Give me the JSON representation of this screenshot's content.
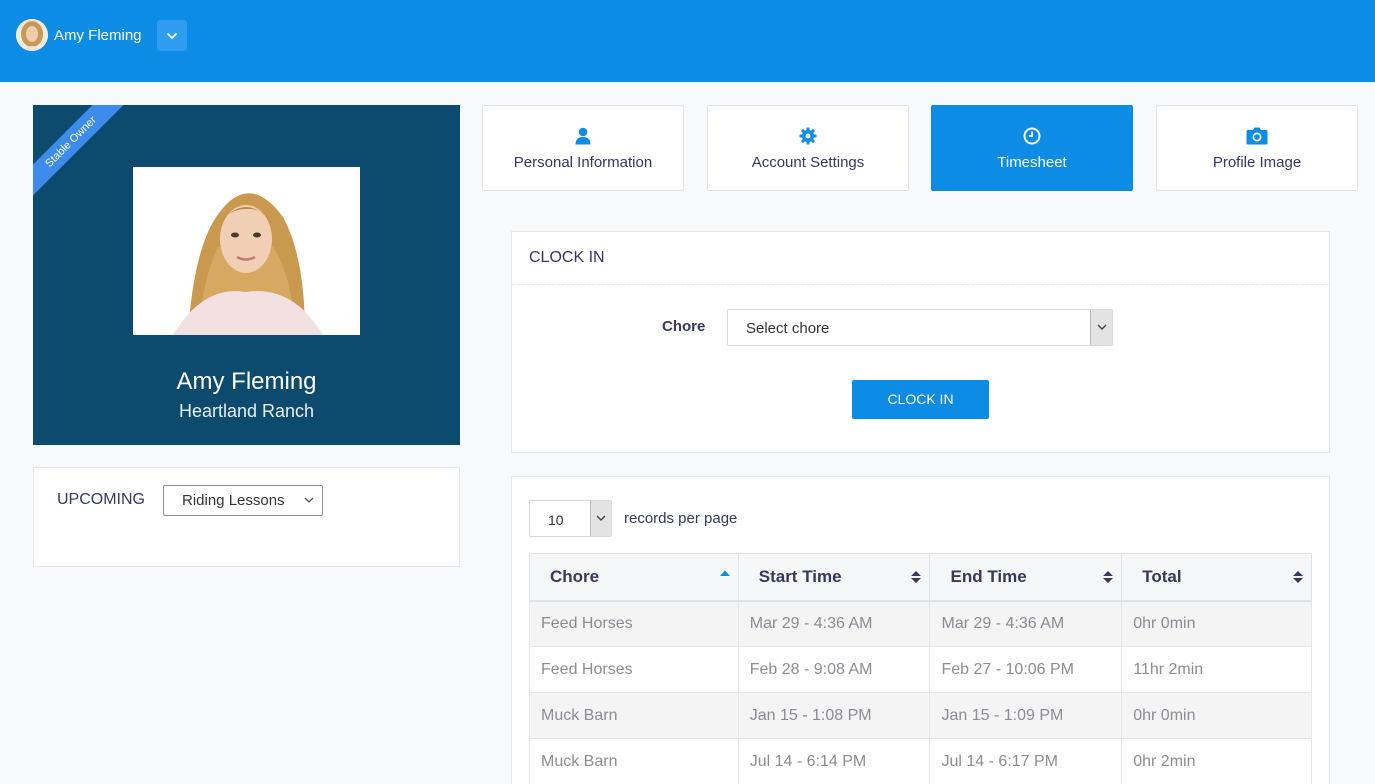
{
  "topbar": {
    "user_name": "Amy Fleming",
    "color": "#0c8ce4"
  },
  "profile": {
    "ribbon": "Stable Owner",
    "name": "Amy Fleming",
    "ranch": "Heartland Ranch",
    "card_color": "#0c4a6e"
  },
  "upcoming": {
    "label": "UPCOMING",
    "selected": "Riding Lessons"
  },
  "tabs": [
    {
      "label": "Personal Information",
      "icon": "user-icon",
      "active": false
    },
    {
      "label": "Account Settings",
      "icon": "gear-icon",
      "active": false
    },
    {
      "label": "Timesheet",
      "icon": "clock-icon",
      "active": true
    },
    {
      "label": "Profile Image",
      "icon": "camera-icon",
      "active": false
    }
  ],
  "clock_in": {
    "title": "CLOCK IN",
    "chore_label": "Chore",
    "chore_placeholder": "Select chore",
    "button_label": "CLOCK IN"
  },
  "records": {
    "page_length": "10",
    "length_label": "records per page"
  },
  "table": {
    "columns": [
      "Chore",
      "Start Time",
      "End Time",
      "Total"
    ],
    "sorted_column": "Chore",
    "rows": [
      [
        "Feed Horses",
        "Mar 29 - 4:36 AM",
        "Mar 29 - 4:36 AM",
        "0hr 0min"
      ],
      [
        "Feed Horses",
        "Feb 28 - 9:08 AM",
        "Feb 27 - 10:06 PM",
        "11hr 2min"
      ],
      [
        "Muck Barn",
        "Jan 15 - 1:08 PM",
        "Jan 15 - 1:09 PM",
        "0hr 0min"
      ],
      [
        "Muck Barn",
        "Jul 14 - 6:14 PM",
        "Jul 14 - 6:17 PM",
        "0hr 2min"
      ]
    ]
  }
}
